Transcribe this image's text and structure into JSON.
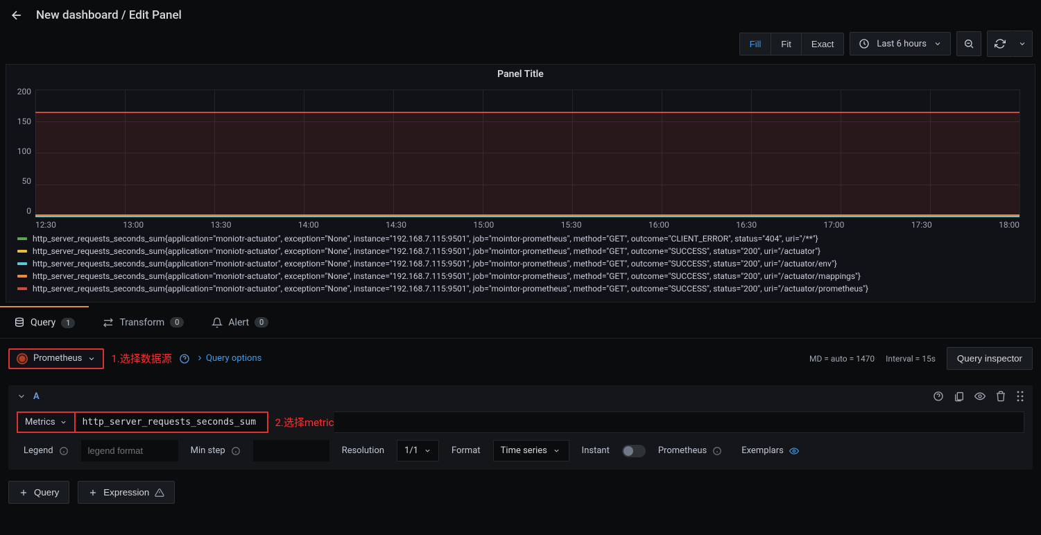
{
  "breadcrumb": "New dashboard / Edit Panel",
  "toolbar": {
    "fill": "Fill",
    "fit": "Fit",
    "exact": "Exact",
    "time_range": "Last 6 hours"
  },
  "panel": {
    "title": "Panel Title"
  },
  "chart_data": {
    "type": "line",
    "ylim": [
      0,
      200
    ],
    "yticks": [
      "200",
      "150",
      "100",
      "50",
      "0"
    ],
    "xticks": [
      "12:30",
      "13:00",
      "13:30",
      "14:00",
      "14:30",
      "15:00",
      "15:30",
      "16:00",
      "16:30",
      "17:00",
      "17:30",
      "18:00"
    ],
    "series": [
      {
        "name": "http_server_requests_seconds_sum{application=\"moniotr-actuator\", exception=\"None\", instance=\"192.168.7.115:9501\", job=\"mointor-prometheus\", method=\"GET\", outcome=\"CLIENT_ERROR\", status=\"404\", uri=\"/**\"}",
        "color": "#5aa84f",
        "value": 0.5
      },
      {
        "name": "http_server_requests_seconds_sum{application=\"moniotr-actuator\", exception=\"None\", instance=\"192.168.7.115:9501\", job=\"mointor-prometheus\", method=\"GET\", outcome=\"SUCCESS\", status=\"200\", uri=\"/actuator\"}",
        "color": "#e5bd3a",
        "value": 0.5
      },
      {
        "name": "http_server_requests_seconds_sum{application=\"moniotr-actuator\", exception=\"None\", instance=\"192.168.7.115:9501\", job=\"mointor-prometheus\", method=\"GET\", outcome=\"SUCCESS\", status=\"200\", uri=\"/actuator/env\"}",
        "color": "#5bc7d6",
        "value": 0.5
      },
      {
        "name": "http_server_requests_seconds_sum{application=\"moniotr-actuator\", exception=\"None\", instance=\"192.168.7.115:9501\", job=\"mointor-prometheus\", method=\"GET\", outcome=\"SUCCESS\", status=\"200\", uri=\"/actuator/mappings\"}",
        "color": "#e78b3b",
        "value": 2
      },
      {
        "name": "http_server_requests_seconds_sum{application=\"moniotr-actuator\", exception=\"None\", instance=\"192.168.7.115:9501\", job=\"mointor-prometheus\", method=\"GET\", outcome=\"SUCCESS\", status=\"200\", uri=\"/actuator/prometheus\"}",
        "color": "#d44a3a",
        "value": 165
      }
    ]
  },
  "tabs": {
    "query": "Query",
    "query_count": "1",
    "transform": "Transform",
    "transform_count": "0",
    "alert": "Alert",
    "alert_count": "0"
  },
  "datasource": {
    "name": "Prometheus",
    "annotation": "1.选择数据源",
    "query_options": "Query options",
    "md": "MD = auto = 1470",
    "interval": "Interval = 15s",
    "inspector": "Query inspector"
  },
  "query": {
    "letter": "A",
    "metrics_label": "Metrics",
    "metrics_value": "http_server_requests_seconds_sum",
    "metrics_annotation": "2.选择metric",
    "legend_label": "Legend",
    "legend_placeholder": "legend format",
    "minstep_label": "Min step",
    "resolution_label": "Resolution",
    "resolution_value": "1/1",
    "format_label": "Format",
    "format_value": "Time series",
    "instant_label": "Instant",
    "prometheus_label": "Prometheus",
    "exemplars_label": "Exemplars"
  },
  "footer": {
    "add_query": "Query",
    "add_expression": "Expression"
  }
}
